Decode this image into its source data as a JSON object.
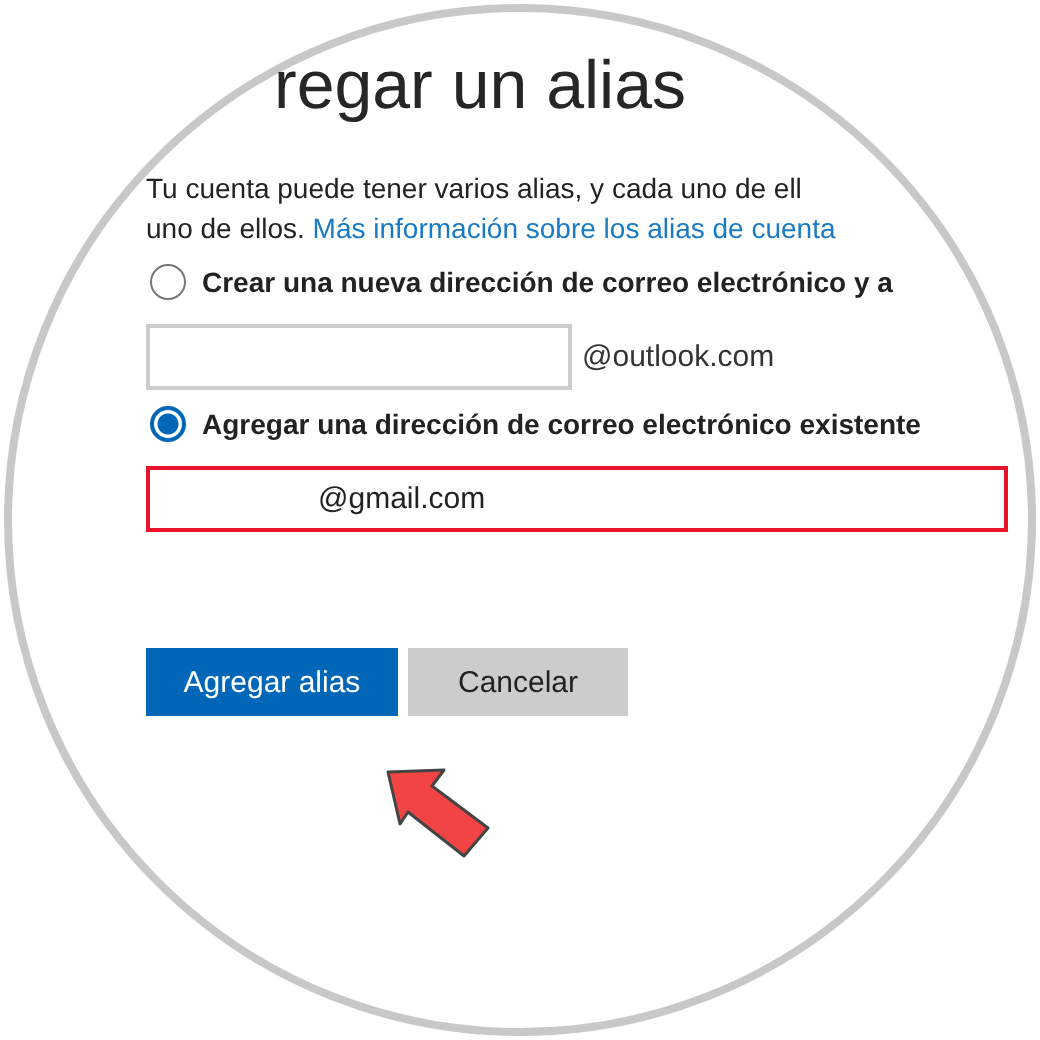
{
  "page": {
    "title": "regar un alias",
    "intro": "Tu cuenta puede tener varios alias, y cada uno de ell",
    "intro_continued": "uno de ellos.",
    "link": "Más información sobre los alias de cuenta"
  },
  "options": [
    {
      "kind": "new",
      "label": "Crear una nueva dirección de correo electrónico y a",
      "selected": false,
      "suffix": "@outlook.com",
      "highlighted": false
    },
    {
      "kind": "existing",
      "label": "Agregar una dirección de correo electrónico existente",
      "selected": true,
      "value": "@gmail.com",
      "highlighted": true
    }
  ],
  "buttons": [
    {
      "kind": "primary",
      "label": "Agregar alias"
    },
    {
      "kind": "secondary",
      "label": "Cancelar"
    }
  ]
}
